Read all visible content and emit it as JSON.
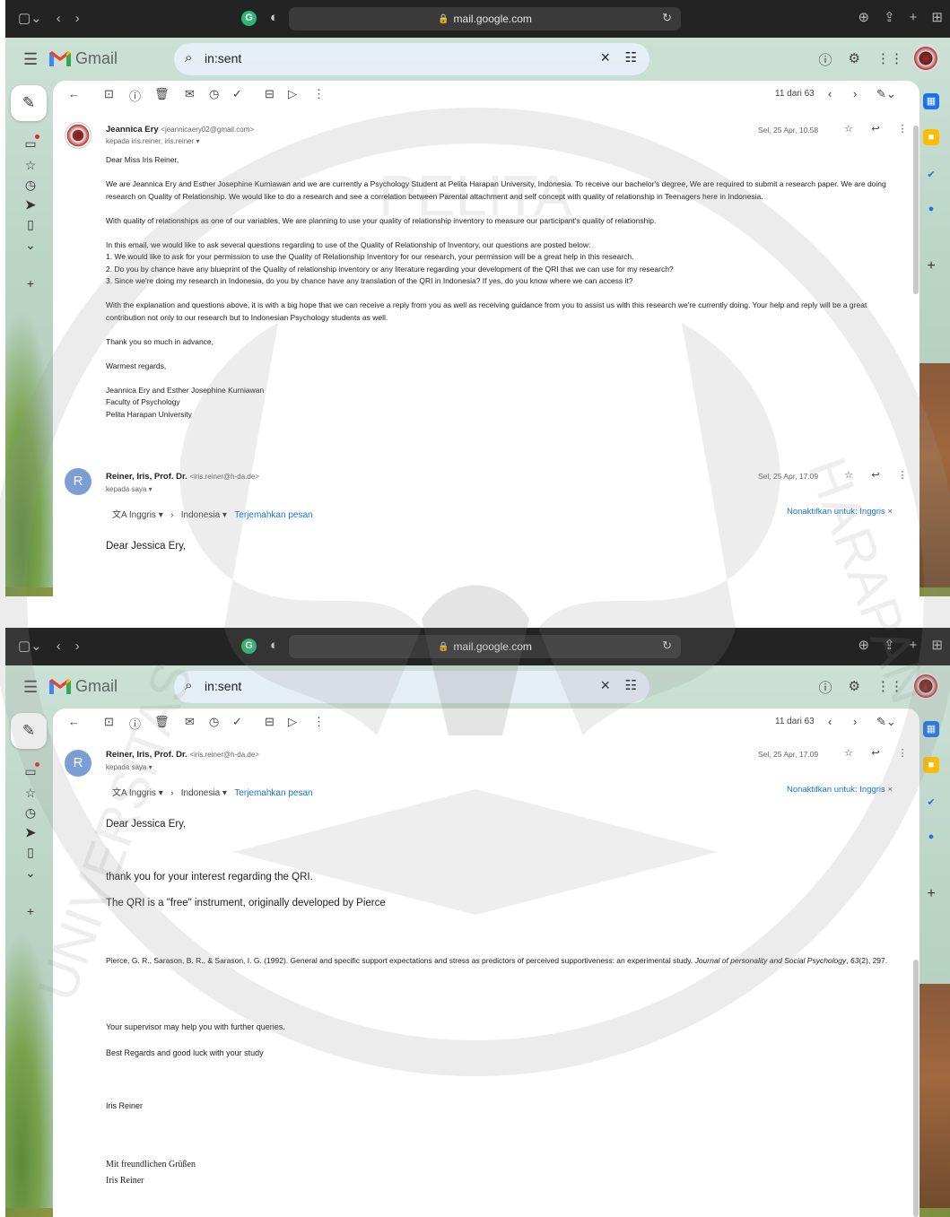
{
  "browser": {
    "url": "mail.google.com"
  },
  "gmail": {
    "app_name": "Gmail",
    "search_value": "in:sent",
    "pager_text": "11 dari 63"
  },
  "email1": {
    "sender_name": "Jeannica Ery",
    "sender_email": "<jeannicaery02@gmail.com>",
    "recipients": "kepada iris.reiner, iris.reiner",
    "date": "Sel, 25 Apr, 10.58",
    "body": [
      "Dear Miss Iris Reiner,",
      "",
      " We are Jeannica Ery and Esther Josephine Kurniawan and we are currently a Psychology Student at Pelita Harapan University, Indonesia. To receive our bachelor's degree, We are required to submit a research paper. We are doing research on Quality of Relationship. We would like to do a research and see a correlation between Parental attachment and self concept  with quality of relationship in Teenagers here in Indonesia.",
      "",
      "With quality of relationships as one of our variables, We are planning to use your quality of relationship inventory to measure our participant's quality of relationship.",
      "",
      "In this email, we would like to ask several questions regarding to use of the Quality of Relationship of Inventory, our questions are posted below:",
      "1. We would like to ask for your permission to use the Quality of Relationship Inventory for our research, your permission will be a great help in this research.",
      "2. Do you by chance have any blueprint of the Quality of relationship inventory or any literature regarding your development of the QRI that we can use for my research?",
      "3. Since we're doing my research in Indonesia, do you by chance have any translation of the QRI in Indonesia? If yes, do you know where we can access it?",
      "",
      "With the explanation and questions above, it is with a big hope that we can receive a reply from you as well as receiving guidance from you to assist us with this research we're currently doing. Your help and reply will be a great contribution not only to our research but to Indonesian Psychology students as well.",
      "",
      "Thank you so much in advance,",
      "",
      "Warmest regards,",
      "",
      "Jeannica Ery and Esther Josephine Kurniawan",
      "Faculty of Psychology",
      "Pelita Harapan University"
    ]
  },
  "email2": {
    "avatar_letter": "R",
    "sender_name": "Reiner, Iris, Prof. Dr.",
    "sender_email": "<iris.reiner@h-da.de>",
    "recipients": "kepada saya",
    "date": "Sel, 25 Apr, 17.09",
    "translate_from": "Inggris",
    "translate_to": "Indonesia",
    "translate_link": "Terjemahkan pesan",
    "translate_off": "Nonaktifkan untuk: Inggris",
    "greeting": "Dear Jessica Ery,",
    "line1": "thank you for your interest regarding the QRI.",
    "line2": "The QRI is a \"free\" instrument, originally developed by Pierce",
    "citation_plain": "Pierce, G. R., Sarason, B. R., & Sarason, I. G. (1992). General and specific support expectations and stress as predictors of perceived supportiveness: an experimental study. ",
    "citation_journal": "Journal of personality and Social Psychology",
    "citation_vol": ", ",
    "citation_volnum": "63",
    "citation_pages": "(2), 297.",
    "line3": "Your supervisor may help you with further queries.",
    "line4": "Best Regards and good luck with your study",
    "sign": "Iris Reiner",
    "closing1": "Mit freundlichen Grüßen",
    "closing2": "Iris Reiner"
  },
  "watermark": {
    "text_top": "PELITA",
    "text_right": "HARAPAN",
    "text_left": "UNIVERSITAS"
  }
}
